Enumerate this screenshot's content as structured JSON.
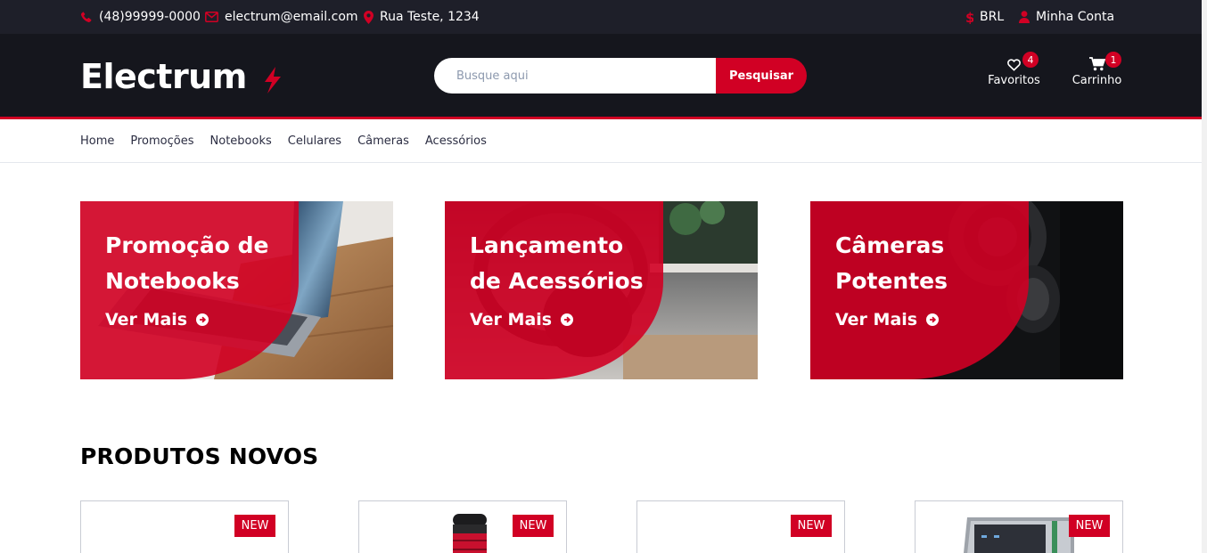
{
  "topbar": {
    "phone": "(48)99999-0000",
    "email": "electrum@email.com",
    "address": "Rua Teste, 1234",
    "currency": "BRL",
    "account": "Minha Conta"
  },
  "header": {
    "logo": "Electrum",
    "search_placeholder": "Busque aqui",
    "search_button": "Pesquisar",
    "favorites_label": "Favoritos",
    "favorites_count": "4",
    "cart_label": "Carrinho",
    "cart_count": "1"
  },
  "nav": {
    "items": [
      "Home",
      "Promoções",
      "Notebooks",
      "Celulares",
      "Câmeras",
      "Acessórios"
    ]
  },
  "banners": [
    {
      "line1": "Promoção de",
      "line2": "Notebooks",
      "cta": "Ver Mais"
    },
    {
      "line1": "Lançamento",
      "line2": "de Acessórios",
      "cta": "Ver Mais"
    },
    {
      "line1": "Câmeras",
      "line2": "Potentes",
      "cta": "Ver Mais"
    }
  ],
  "section": {
    "title": "PRODUTOS NOVOS"
  },
  "products": [
    {
      "badge": "NEW"
    },
    {
      "badge": "NEW"
    },
    {
      "badge": "NEW"
    },
    {
      "badge": "NEW"
    }
  ],
  "colors": {
    "accent": "#d10024",
    "header_bg": "#15161d",
    "topbar_bg": "#1e1f29"
  }
}
